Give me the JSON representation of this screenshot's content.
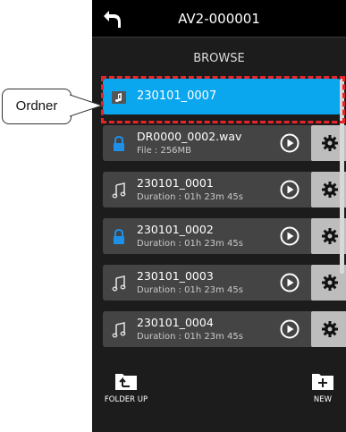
{
  "header": {
    "title": "AV2-000001",
    "back_icon": "back-arrow-icon"
  },
  "subtitle": "BROWSE",
  "callout": {
    "label": "Ordner"
  },
  "items": [
    {
      "name": "230101_0007",
      "detail": "",
      "icon": "folder-music-icon",
      "selected": true
    },
    {
      "name": "DR0000_0002.wav",
      "detail": "File : 256MB",
      "icon": "lock-icon"
    },
    {
      "name": "230101_0001",
      "detail": "Duration : 01h 23m 45s",
      "icon": "music-note-icon"
    },
    {
      "name": "230101_0002",
      "detail": "Duration : 01h 23m 45s",
      "icon": "lock-icon"
    },
    {
      "name": "230101_0003",
      "detail": "Duration : 01h 23m 45s",
      "icon": "music-note-icon"
    },
    {
      "name": "230101_0004",
      "detail": "Duration : 01h 23m 45s",
      "icon": "music-note-icon"
    }
  ],
  "footer": {
    "folder_up": "FOLDER UP",
    "new": "NEW"
  },
  "colors": {
    "selected": "#0aa6ee",
    "lock": "#1e90e8",
    "highlight": "#e8242b",
    "row": "#444444",
    "gear_button": "#bdbdbd"
  }
}
